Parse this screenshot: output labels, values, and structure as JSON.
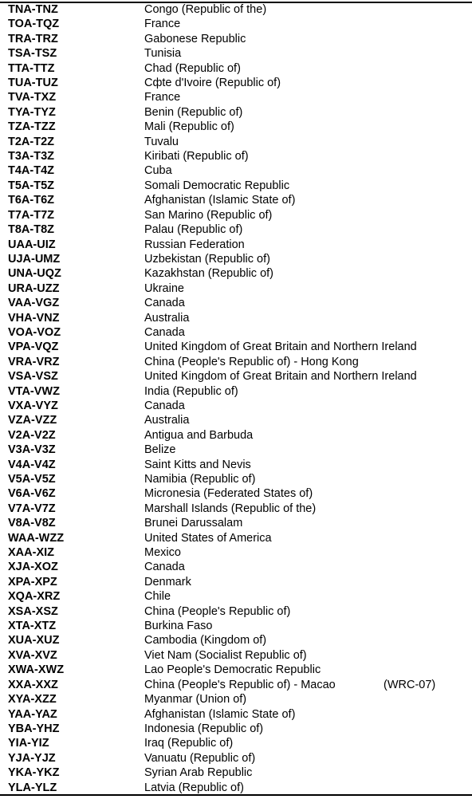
{
  "rows": [
    {
      "code": "TNA-TNZ",
      "country": "Congo (Republic of the)"
    },
    {
      "code": "TOA-TQZ",
      "country": "France"
    },
    {
      "code": "TRA-TRZ",
      "country": "Gabonese Republic"
    },
    {
      "code": "TSA-TSZ",
      "country": "Tunisia"
    },
    {
      "code": "TTA-TTZ",
      "country": "Chad (Republic of)"
    },
    {
      "code": "TUA-TUZ",
      "country": "Cфte d'Ivoire (Republic of)"
    },
    {
      "code": "TVA-TXZ",
      "country": "France"
    },
    {
      "code": "TYA-TYZ",
      "country": "Benin (Republic of)"
    },
    {
      "code": "TZA-TZZ",
      "country": "Mali (Republic of)"
    },
    {
      "code": "T2A-T2Z",
      "country": "Tuvalu"
    },
    {
      "code": "T3A-T3Z",
      "country": "Kiribati (Republic of)"
    },
    {
      "code": "T4A-T4Z",
      "country": "Cuba"
    },
    {
      "code": "T5A-T5Z",
      "country": "Somali Democratic Republic"
    },
    {
      "code": "T6A-T6Z",
      "country": "Afghanistan (Islamic State of)"
    },
    {
      "code": "T7A-T7Z",
      "country": "San Marino (Republic of)"
    },
    {
      "code": "T8A-T8Z",
      "country": "Palau (Republic of)"
    },
    {
      "code": "UAA-UIZ",
      "country": "Russian Federation"
    },
    {
      "code": "UJA-UMZ",
      "country": "Uzbekistan (Republic of)"
    },
    {
      "code": "UNA-UQZ",
      "country": "Kazakhstan (Republic of)"
    },
    {
      "code": "URA-UZZ",
      "country": "Ukraine"
    },
    {
      "code": "VAA-VGZ",
      "country": "Canada"
    },
    {
      "code": "VHA-VNZ",
      "country": "Australia"
    },
    {
      "code": "VOA-VOZ",
      "country": "Canada"
    },
    {
      "code": "VPA-VQZ",
      "country": "United Kingdom of Great Britain and Northern Ireland"
    },
    {
      "code": "VRA-VRZ",
      "country": "China (People's Republic of) - Hong Kong"
    },
    {
      "code": "VSA-VSZ",
      "country": "United Kingdom of Great Britain and Northern Ireland"
    },
    {
      "code": "VTA-VWZ",
      "country": "India (Republic of)"
    },
    {
      "code": "VXA-VYZ",
      "country": "Canada"
    },
    {
      "code": "VZA-VZZ",
      "country": "Australia"
    },
    {
      "code": "V2A-V2Z",
      "country": "Antigua and Barbuda"
    },
    {
      "code": "V3A-V3Z",
      "country": "Belize"
    },
    {
      "code": "V4A-V4Z",
      "country": "Saint Kitts and Nevis"
    },
    {
      "code": "V5A-V5Z",
      "country": "Namibia (Republic of)"
    },
    {
      "code": "V6A-V6Z",
      "country": "Micronesia (Federated States of)"
    },
    {
      "code": "V7A-V7Z",
      "country": "Marshall Islands (Republic of the)"
    },
    {
      "code": "V8A-V8Z",
      "country": "Brunei Darussalam"
    },
    {
      "code": "WAA-WZZ",
      "country": "United States of America"
    },
    {
      "code": "XAA-XIZ",
      "country": "Mexico"
    },
    {
      "code": "XJA-XOZ",
      "country": "Canada"
    },
    {
      "code": "XPA-XPZ",
      "country": "Denmark"
    },
    {
      "code": "XQA-XRZ",
      "country": "Chile"
    },
    {
      "code": "XSA-XSZ",
      "country": "China (People's Republic of)"
    },
    {
      "code": "XTA-XTZ",
      "country": "Burkina Faso"
    },
    {
      "code": "XUA-XUZ",
      "country": "Cambodia (Kingdom of)"
    },
    {
      "code": "XVA-XVZ",
      "country": "Viet Nam (Socialist Republic of)"
    },
    {
      "code": "XWA-XWZ",
      "country": "Lao People's Democratic Republic"
    },
    {
      "code": "XXA-XXZ",
      "country": "China (People's Republic of) - Macao",
      "note": "(WRC-07)"
    },
    {
      "code": "XYA-XZZ",
      "country": "Myanmar (Union of)"
    },
    {
      "code": "YAA-YAZ",
      "country": "Afghanistan (Islamic State of)"
    },
    {
      "code": "YBA-YHZ",
      "country": "Indonesia (Republic of)"
    },
    {
      "code": "YIA-YIZ",
      "country": "Iraq (Republic of)"
    },
    {
      "code": "YJA-YJZ",
      "country": "Vanuatu (Republic of)"
    },
    {
      "code": "YKA-YKZ",
      "country": "Syrian Arab Republic"
    },
    {
      "code": "YLA-YLZ",
      "country": "Latvia (Republic of)"
    }
  ]
}
